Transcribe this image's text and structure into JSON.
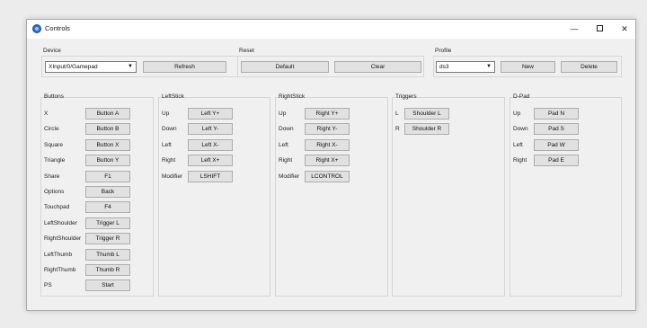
{
  "window": {
    "title": "Controls",
    "minimize_glyph": "—",
    "close_glyph": "✕"
  },
  "device": {
    "label": "Device",
    "selected": "XInput/0/Gamepad",
    "refresh_label": "Refresh"
  },
  "reset": {
    "label": "Reset",
    "default_label": "Default",
    "clear_label": "Clear"
  },
  "profile": {
    "label": "Profile",
    "selected": "ds3",
    "new_label": "New",
    "delete_label": "Delete"
  },
  "buttons": {
    "label": "Buttons",
    "rows": [
      {
        "name": "X",
        "value": "Button A"
      },
      {
        "name": "Circle",
        "value": "Button B"
      },
      {
        "name": "Square",
        "value": "Button X"
      },
      {
        "name": "Triangle",
        "value": "Button Y"
      },
      {
        "name": "Share",
        "value": "F1"
      },
      {
        "name": "Options",
        "value": "Back"
      },
      {
        "name": "Touchpad",
        "value": "F4"
      },
      {
        "name": "LeftShoulder",
        "value": "Trigger L"
      },
      {
        "name": "RightShoulder",
        "value": "Trigger R"
      },
      {
        "name": "LeftThumb",
        "value": "Thumb L"
      },
      {
        "name": "RightThumb",
        "value": "Thumb R"
      },
      {
        "name": "PS",
        "value": "Start"
      }
    ]
  },
  "left_stick": {
    "label": "LeftStick",
    "rows": [
      {
        "name": "Up",
        "value": "Left Y+"
      },
      {
        "name": "Down",
        "value": "Left Y-"
      },
      {
        "name": "Left",
        "value": "Left X-"
      },
      {
        "name": "Right",
        "value": "Left X+"
      },
      {
        "name": "Modifier",
        "value": "LSHIFT"
      }
    ]
  },
  "right_stick": {
    "label": "RightStick",
    "rows": [
      {
        "name": "Up",
        "value": "Right Y+"
      },
      {
        "name": "Down",
        "value": "Right Y-"
      },
      {
        "name": "Left",
        "value": "Right X-"
      },
      {
        "name": "Right",
        "value": "Right X+"
      },
      {
        "name": "Modifier",
        "value": "LCONTROL"
      }
    ]
  },
  "triggers": {
    "label": "Triggers",
    "rows": [
      {
        "name": "L",
        "value": "Shoulder L"
      },
      {
        "name": "R",
        "value": "Shoulder R"
      }
    ]
  },
  "dpad": {
    "label": "D-Pad",
    "rows": [
      {
        "name": "Up",
        "value": "Pad N"
      },
      {
        "name": "Down",
        "value": "Pad S"
      },
      {
        "name": "Left",
        "value": "Pad W"
      },
      {
        "name": "Right",
        "value": "Pad E"
      }
    ]
  },
  "icons": {
    "app": "gamepad-app-icon",
    "dropdown": "chevron-down-icon"
  }
}
